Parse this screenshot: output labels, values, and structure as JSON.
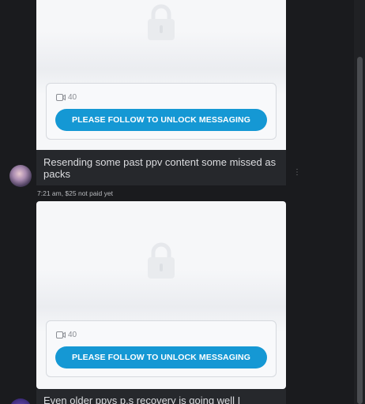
{
  "posts": [
    {
      "video_count": "40",
      "unlock_label": "PLEASE FOLLOW TO UNLOCK MESSAGING",
      "message": "Resending some past ppv content some missed as packs",
      "meta": "7:21 am,  $25 not paid yet"
    },
    {
      "video_count": "40",
      "unlock_label": "PLEASE FOLLOW TO UNLOCK MESSAGING",
      "message": "Even older ppvs p.s recovery is going well I promise"
    }
  ],
  "colors": {
    "background": "#1a1b1e",
    "card": "#f6f7f9",
    "bubble": "#26282c",
    "accent": "#1598d4"
  },
  "icons": [
    "lock-icon",
    "video-icon",
    "more-icon",
    "avatar"
  ]
}
